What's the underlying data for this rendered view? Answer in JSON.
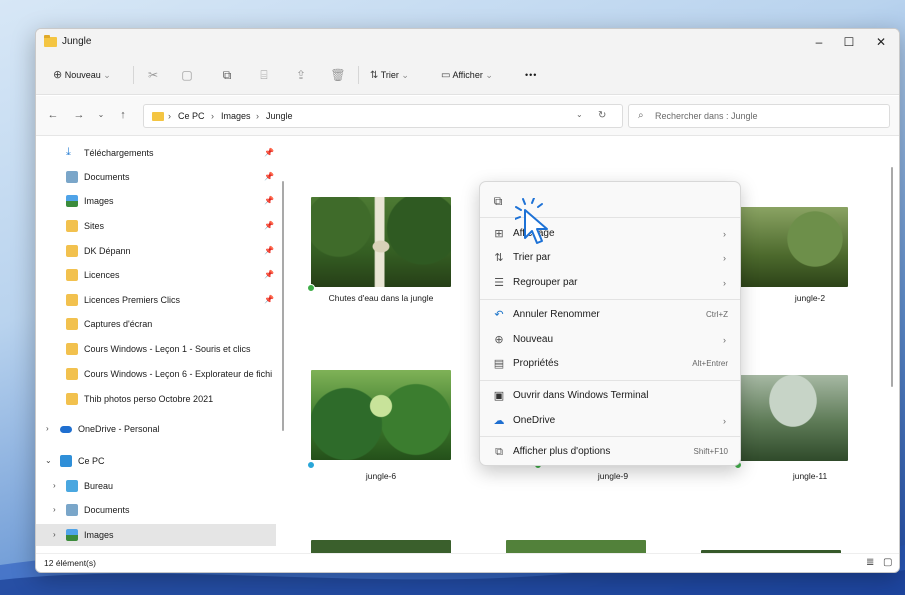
{
  "window": {
    "title": "Jungle",
    "controls": {
      "minimize": "–",
      "maximize": "☐",
      "close": "✕"
    }
  },
  "toolbar": {
    "new_label": "Nouveau",
    "sort_label": "Trier",
    "view_label": "Afficher",
    "more_label": "•••"
  },
  "address": {
    "crumbs": [
      "Ce PC",
      "Images",
      "Jungle"
    ],
    "search_placeholder": "Rechercher dans : Jungle"
  },
  "sidebar": {
    "quick_access": [
      {
        "label": "Téléchargements",
        "icon": "download-icon",
        "pinned": true
      },
      {
        "label": "Documents",
        "icon": "documents-icon",
        "pinned": true
      },
      {
        "label": "Images",
        "icon": "images-icon",
        "pinned": true
      },
      {
        "label": "Sites",
        "icon": "folder-icon",
        "pinned": true
      },
      {
        "label": "DK Dépann",
        "icon": "folder-icon",
        "pinned": true
      },
      {
        "label": "Licences",
        "icon": "folder-icon",
        "pinned": true
      },
      {
        "label": "Licences Premiers Clics",
        "icon": "folder-icon",
        "pinned": true
      },
      {
        "label": "Captures d'écran",
        "icon": "folder-icon",
        "pinned": false
      },
      {
        "label": "Cours Windows - Leçon 1 - Souris et clics",
        "icon": "folder-icon",
        "pinned": false
      },
      {
        "label": "Cours Windows - Leçon 6 - Explorateur de fichi",
        "icon": "folder-icon",
        "pinned": false
      },
      {
        "label": "Thib photos perso Octobre 2021",
        "icon": "folder-icon",
        "pinned": false
      }
    ],
    "onedrive": "OneDrive - Personal",
    "this_pc": "Ce PC",
    "pc_children": [
      "Bureau",
      "Documents",
      "Images"
    ]
  },
  "content": {
    "items": [
      {
        "label": "Chutes d'eau dans la jungle",
        "sync": "green"
      },
      {
        "label": "",
        "sync": "none"
      },
      {
        "label": "jungle-2",
        "sync": "none"
      },
      {
        "label": "jungle-6",
        "sync": "blue"
      },
      {
        "label": "jungle-9",
        "sync": "green"
      },
      {
        "label": "jungle-11",
        "sync": "green"
      }
    ]
  },
  "status": {
    "count": "12 élément(s)"
  },
  "context_menu": {
    "items": [
      {
        "label": "Affichage",
        "icon": "grid-icon",
        "shortcut": "",
        "submenu": true
      },
      {
        "label": "Trier par",
        "icon": "sort-icon",
        "shortcut": "",
        "submenu": true
      },
      {
        "label": "Regrouper par",
        "icon": "group-icon",
        "shortcut": "",
        "submenu": true
      },
      {
        "label": "Annuler Renommer",
        "icon": "undo-icon",
        "shortcut": "Ctrl+Z",
        "submenu": false
      },
      {
        "label": "Nouveau",
        "icon": "new-icon",
        "shortcut": "",
        "submenu": true
      },
      {
        "label": "Propriétés",
        "icon": "properties-icon",
        "shortcut": "Alt+Entrer",
        "submenu": false
      },
      {
        "label": "Ouvrir dans Windows Terminal",
        "icon": "terminal-icon",
        "shortcut": "",
        "submenu": false
      },
      {
        "label": "OneDrive",
        "icon": "cloud-icon",
        "shortcut": "",
        "submenu": true
      },
      {
        "label": "Afficher plus d'options",
        "icon": "more-options-icon",
        "shortcut": "Shift+F10",
        "submenu": false
      }
    ],
    "submenu_glyph": "›"
  }
}
